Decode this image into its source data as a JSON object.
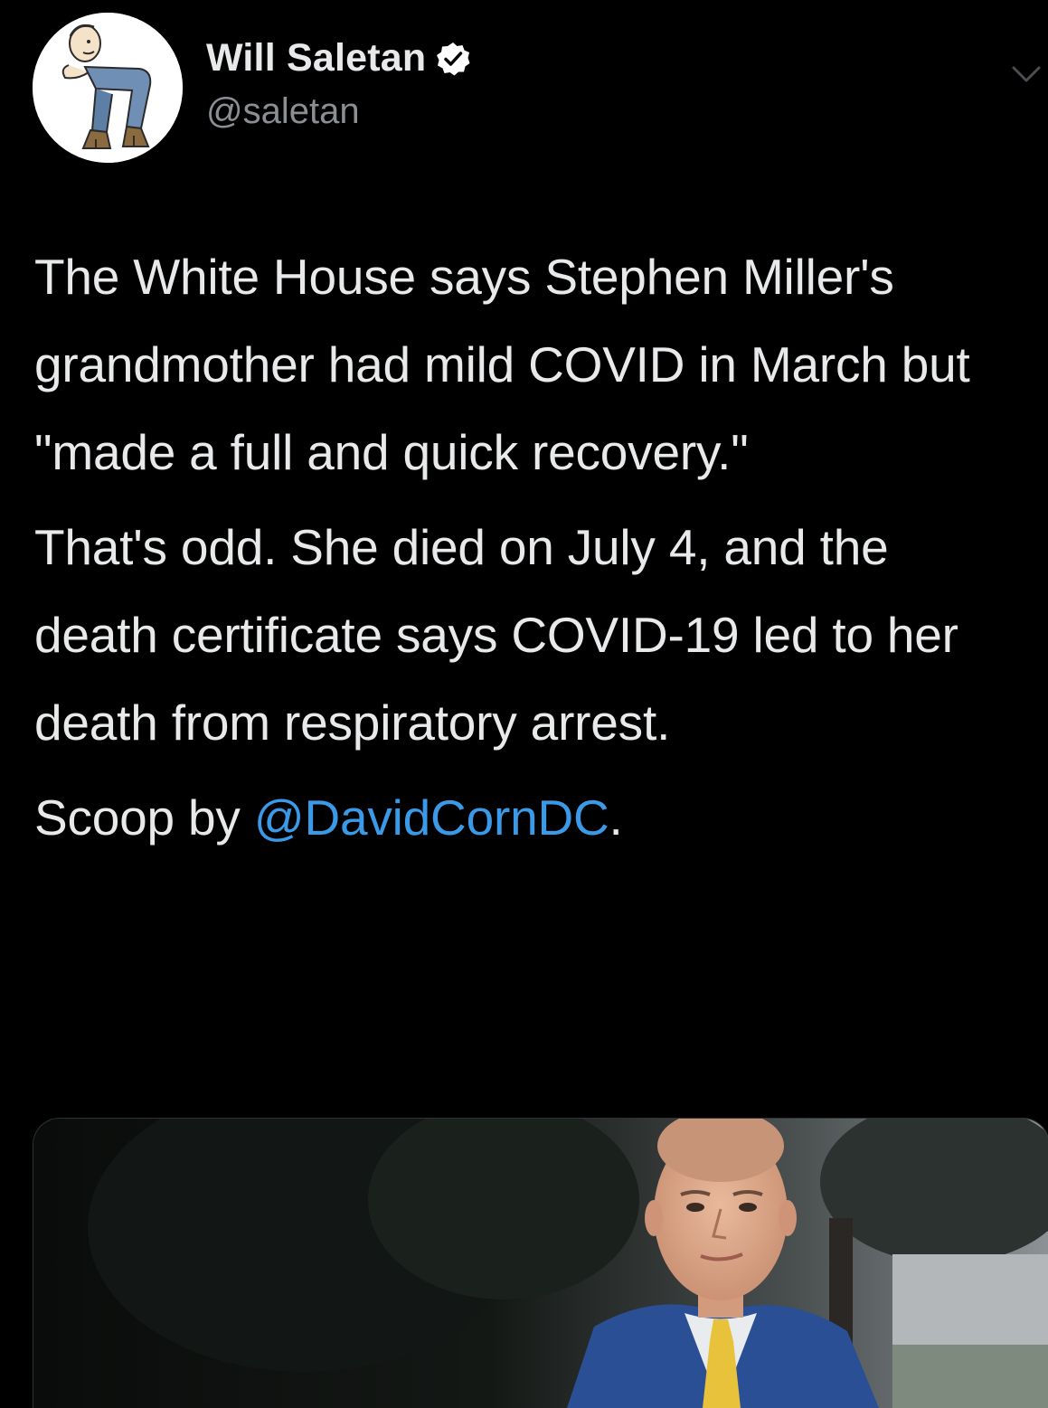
{
  "tweet": {
    "author": {
      "display_name": "Will Saletan",
      "handle": "@saletan",
      "verified": true,
      "avatar_icon": "cartoon-avatar-icon",
      "verified_icon": "verified-badge-icon"
    },
    "menu_icon": "chevron-down-icon",
    "paragraphs": [
      "The White House says Stephen Miller's grandmother had mild COVID in March but \"made a full and quick recovery.\"",
      "That's odd. She died on July 4, and the death certificate says COVID-19 led to her death from respiratory arrest."
    ],
    "scoop": {
      "prefix": "Scoop by ",
      "mention": "@DavidCornDC",
      "suffix": "."
    }
  },
  "colors": {
    "background": "#000000",
    "text": "#e7e9ea",
    "secondary_text": "#8b8f94",
    "link": "#3b9ae8",
    "verified_badge": "#ffffff"
  }
}
